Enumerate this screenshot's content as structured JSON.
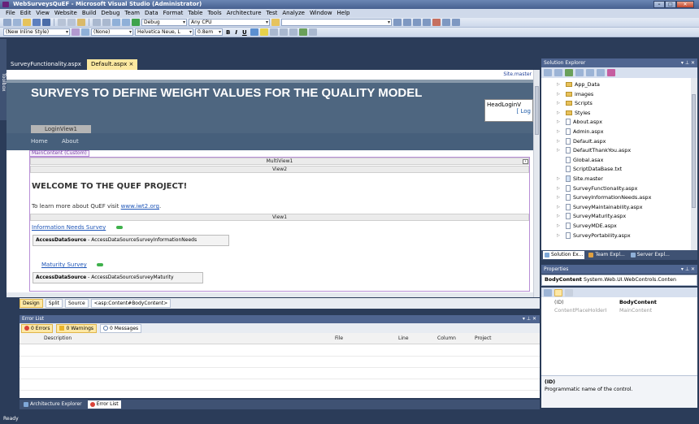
{
  "window": {
    "title": "WebSurveysQuEF - Microsoft Visual Studio (Administrator)"
  },
  "menu": [
    "File",
    "Edit",
    "View",
    "Website",
    "Build",
    "Debug",
    "Team",
    "Data",
    "Format",
    "Table",
    "Tools",
    "Architecture",
    "Test",
    "Analyze",
    "Window",
    "Help"
  ],
  "toolbar": {
    "config": "Debug",
    "platform": "Any CPU",
    "style": "(New Inline Style)",
    "target": "(None)",
    "font": "Helvetica Neue, L",
    "size": "0.8em",
    "bold": "B",
    "italic": "I",
    "underline": "U"
  },
  "left_tab": "Toolbox",
  "tabs": [
    {
      "label": "SurveyFunctionality.aspx"
    },
    {
      "label": "Default.aspx ×"
    }
  ],
  "editor": {
    "site_master": "Site.master",
    "banner_title": "SURVEYS TO DEFINE WEIGHT VALUES FOR THE QUALITY MODEL",
    "head_login": "HeadLoginV",
    "head_login_link": "[ Log",
    "login_view": "LoginView1",
    "nav": [
      "Home",
      "About"
    ],
    "main_content_label": "MainContent (Custom)",
    "multiview": "MultiView1",
    "view2": "View2",
    "welcome": "WELCOME TO THE QUEF PROJECT!",
    "learn_text": "To learn more about QuEF visit",
    "learn_link": "www.iwt2.org",
    "learn_end": ".",
    "view1": "View1",
    "link1": "Information Needs Survey",
    "ds1_bold": "AccessDataSource",
    "ds1_rest": " - AccessDataSourceSurveyInformationNeeds",
    "link2": "Maturity Survey",
    "ds2_bold": "AccessDataSource",
    "ds2_rest": " - AccessDataSourceSurveyMaturity"
  },
  "viewbar": {
    "design": "Design",
    "split": "Split",
    "source": "Source",
    "breadcrumb": "<asp:Content#BodyContent>"
  },
  "error_list": {
    "title": "Error List",
    "errors": "0 Errors",
    "warnings": "0 Warnings",
    "messages": "0 Messages",
    "columns": [
      "Description",
      "File",
      "Line",
      "Column",
      "Project"
    ]
  },
  "bottom_tabs": [
    "Architecture Explorer",
    "Error List"
  ],
  "status": "Ready",
  "solution_explorer": {
    "title": "Solution Explorer",
    "items": [
      {
        "label": "App_Data",
        "kind": "folder",
        "expand": true
      },
      {
        "label": "images",
        "kind": "folder",
        "expand": true
      },
      {
        "label": "Scripts",
        "kind": "folder",
        "expand": true
      },
      {
        "label": "Styles",
        "kind": "folder",
        "expand": true
      },
      {
        "label": "About.aspx",
        "kind": "file",
        "expand": true
      },
      {
        "label": "Admin.aspx",
        "kind": "file",
        "expand": true
      },
      {
        "label": "Default.aspx",
        "kind": "file",
        "expand": true
      },
      {
        "label": "DefaultThankYou.aspx",
        "kind": "file",
        "expand": true
      },
      {
        "label": "Global.asax",
        "kind": "file",
        "expand": false
      },
      {
        "label": "ScriptDataBase.txt",
        "kind": "file",
        "expand": false
      },
      {
        "label": "Site.master",
        "kind": "master",
        "expand": true
      },
      {
        "label": "SurveyFunctionality.aspx",
        "kind": "file",
        "expand": true
      },
      {
        "label": "SurveyInformationNeeds.aspx",
        "kind": "file",
        "expand": true
      },
      {
        "label": "SurveyMaintainability.aspx",
        "kind": "file",
        "expand": true
      },
      {
        "label": "SurveyMaturity.aspx",
        "kind": "file",
        "expand": true
      },
      {
        "label": "SurveyMDE.aspx",
        "kind": "file",
        "expand": true
      },
      {
        "label": "SurveyPortability.aspx",
        "kind": "file",
        "expand": true
      }
    ],
    "tabs": [
      "Solution Ex...",
      "Team Expl...",
      "Server Expl..."
    ]
  },
  "properties": {
    "title": "Properties",
    "object_name": "BodyContent",
    "object_type": " System.Web.UI.WebControls.Conten",
    "rows": [
      {
        "key": "(ID)",
        "value": "BodyContent"
      },
      {
        "key": "ContentPlaceHolderI",
        "value": "MainContent"
      }
    ],
    "desc_title": "(ID)",
    "desc_text": "Programmatic name of the control."
  },
  "colors": {
    "chrome_dark": "#2b3c59",
    "banner": "#4e6680",
    "active_tab": "#fbe8a0",
    "link": "#1f56b8"
  }
}
